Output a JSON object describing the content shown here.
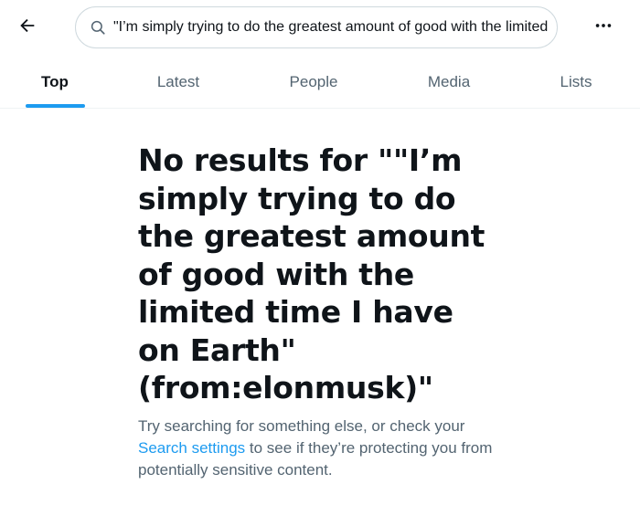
{
  "search": {
    "value": "\"I’m simply trying to do the greatest amount of good with the limited time I have on Earth\" (from:elonmusk)"
  },
  "tabs": [
    {
      "label": "Top",
      "active": true
    },
    {
      "label": "Latest",
      "active": false
    },
    {
      "label": "People",
      "active": false
    },
    {
      "label": "Media",
      "active": false
    },
    {
      "label": "Lists",
      "active": false
    }
  ],
  "empty_state": {
    "title": "No results for \"\"I’m simply trying to do the greatest amount of good with the limited time I have on Earth\" (from:elonmusk)\"",
    "message_prefix": "Try searching for something else, or check your ",
    "link": "Search settings",
    "message_suffix": " to see if they’re protecting you from potentially sensitive content."
  },
  "colors": {
    "accent": "#1d9bf0",
    "text_primary": "#0f1419",
    "text_secondary": "#536471",
    "border": "#cfd9de"
  },
  "icons": {
    "back": "arrow-left-icon",
    "search": "search-icon",
    "more": "more-horizontal-icon"
  }
}
